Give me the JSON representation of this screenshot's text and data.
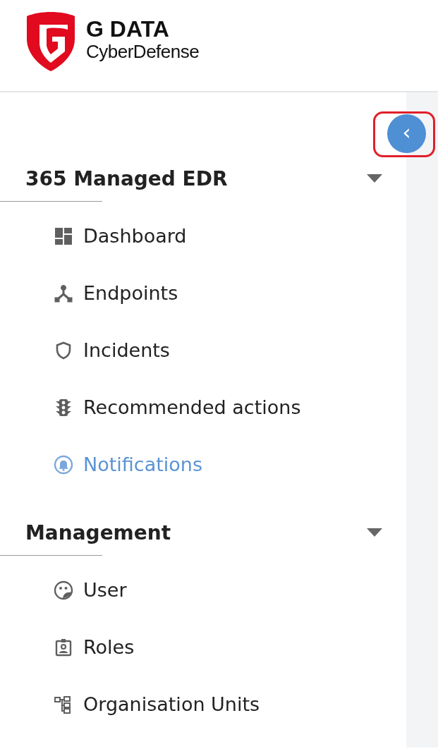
{
  "brand": {
    "name": "G DATA",
    "subtitle": "CyberDefense"
  },
  "sidebar": {
    "collapse_button": {
      "icon": "‹"
    },
    "highlighted": true,
    "sections": [
      {
        "title": "365 Managed EDR",
        "expanded": true,
        "items": [
          {
            "label": "Dashboard",
            "kind": "dashboard",
            "selected": false
          },
          {
            "label": "Endpoints",
            "kind": "endpoints",
            "selected": false
          },
          {
            "label": "Incidents",
            "kind": "shield",
            "selected": false
          },
          {
            "label": "Recommended actions",
            "kind": "traffic",
            "selected": false
          },
          {
            "label": "Notifications",
            "kind": "bell",
            "selected": true
          }
        ]
      },
      {
        "title": "Management",
        "expanded": true,
        "items": [
          {
            "label": "User",
            "kind": "user",
            "selected": false
          },
          {
            "label": "Roles",
            "kind": "badge",
            "selected": false
          },
          {
            "label": "Organisation Units",
            "kind": "org",
            "selected": false
          }
        ]
      }
    ]
  }
}
